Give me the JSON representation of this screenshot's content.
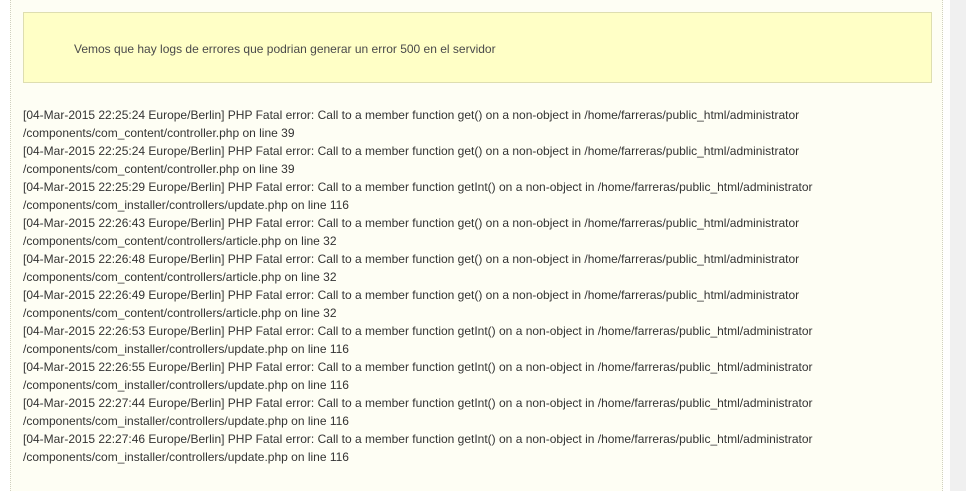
{
  "notice": {
    "message": "Vemos que hay logs de errores que podrian generar un error 500 en el servidor"
  },
  "log": {
    "entries": [
      {
        "line1": "[04-Mar-2015 22:25:24 Europe/Berlin] PHP Fatal error: Call to a member function get() on a non-object in /home/farreras/public_html/administrator",
        "line2": "/components/com_content/controller.php on line 39"
      },
      {
        "line1": "[04-Mar-2015 22:25:24 Europe/Berlin] PHP Fatal error: Call to a member function get() on a non-object in /home/farreras/public_html/administrator",
        "line2": "/components/com_content/controller.php on line 39"
      },
      {
        "line1": "[04-Mar-2015 22:25:29 Europe/Berlin] PHP Fatal error: Call to a member function getInt() on a non-object in /home/farreras/public_html/administrator",
        "line2": "/components/com_installer/controllers/update.php on line 116"
      },
      {
        "line1": "[04-Mar-2015 22:26:43 Europe/Berlin] PHP Fatal error: Call to a member function get() on a non-object in /home/farreras/public_html/administrator",
        "line2": "/components/com_content/controllers/article.php on line 32"
      },
      {
        "line1": "[04-Mar-2015 22:26:48 Europe/Berlin] PHP Fatal error: Call to a member function get() on a non-object in /home/farreras/public_html/administrator",
        "line2": "/components/com_content/controllers/article.php on line 32"
      },
      {
        "line1": "[04-Mar-2015 22:26:49 Europe/Berlin] PHP Fatal error: Call to a member function get() on a non-object in /home/farreras/public_html/administrator",
        "line2": "/components/com_content/controllers/article.php on line 32"
      },
      {
        "line1": "[04-Mar-2015 22:26:53 Europe/Berlin] PHP Fatal error: Call to a member function getInt() on a non-object in /home/farreras/public_html/administrator",
        "line2": "/components/com_installer/controllers/update.php on line 116"
      },
      {
        "line1": "[04-Mar-2015 22:26:55 Europe/Berlin] PHP Fatal error: Call to a member function getInt() on a non-object in /home/farreras/public_html/administrator",
        "line2": "/components/com_installer/controllers/update.php on line 116"
      },
      {
        "line1": "[04-Mar-2015 22:27:44 Europe/Berlin] PHP Fatal error: Call to a member function getInt() on a non-object in /home/farreras/public_html/administrator",
        "line2": "/components/com_installer/controllers/update.php on line 116"
      },
      {
        "line1": "[04-Mar-2015 22:27:46 Europe/Berlin] PHP Fatal error: Call to a member function getInt() on a non-object in /home/farreras/public_html/administrator",
        "line2": "/components/com_installer/controllers/update.php on line 116"
      }
    ]
  }
}
